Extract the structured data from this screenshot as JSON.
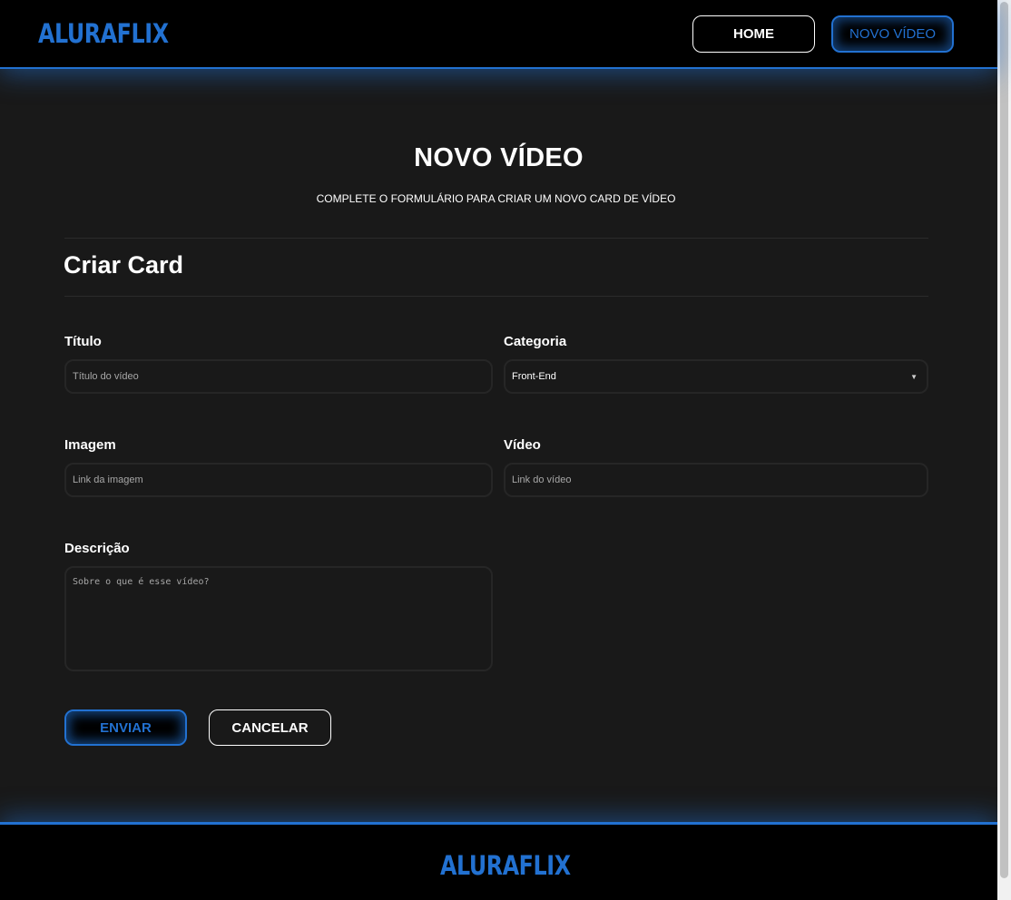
{
  "header": {
    "logo": "ALURAFLIX",
    "nav": {
      "home_label": "HOME",
      "new_video_label": "NOVO VÍDEO"
    }
  },
  "main": {
    "title": "NOVO VÍDEO",
    "subtitle": "COMPLETE O FORMULÁRIO PARA CRIAR UM NOVO CARD DE VÍDEO",
    "section_title": "Criar Card",
    "form": {
      "titulo": {
        "label": "Título",
        "placeholder": "Título do vídeo",
        "value": ""
      },
      "categoria": {
        "label": "Categoria",
        "selected": "Front-End"
      },
      "imagem": {
        "label": "Imagem",
        "placeholder": "Link da imagem",
        "value": ""
      },
      "video": {
        "label": "Vídeo",
        "placeholder": "Link do vídeo",
        "value": ""
      },
      "descricao": {
        "label": "Descrição",
        "placeholder": "Sobre o que é esse vídeo?",
        "value": ""
      }
    },
    "buttons": {
      "send_label": "ENVIAR",
      "cancel_label": "CANCELAR"
    }
  },
  "footer": {
    "logo": "ALURAFLIX"
  },
  "colors": {
    "accent": "#2271d1",
    "background": "#191919",
    "header_bg": "#000000"
  },
  "icons": {
    "select_arrow": "caret-down-icon"
  }
}
